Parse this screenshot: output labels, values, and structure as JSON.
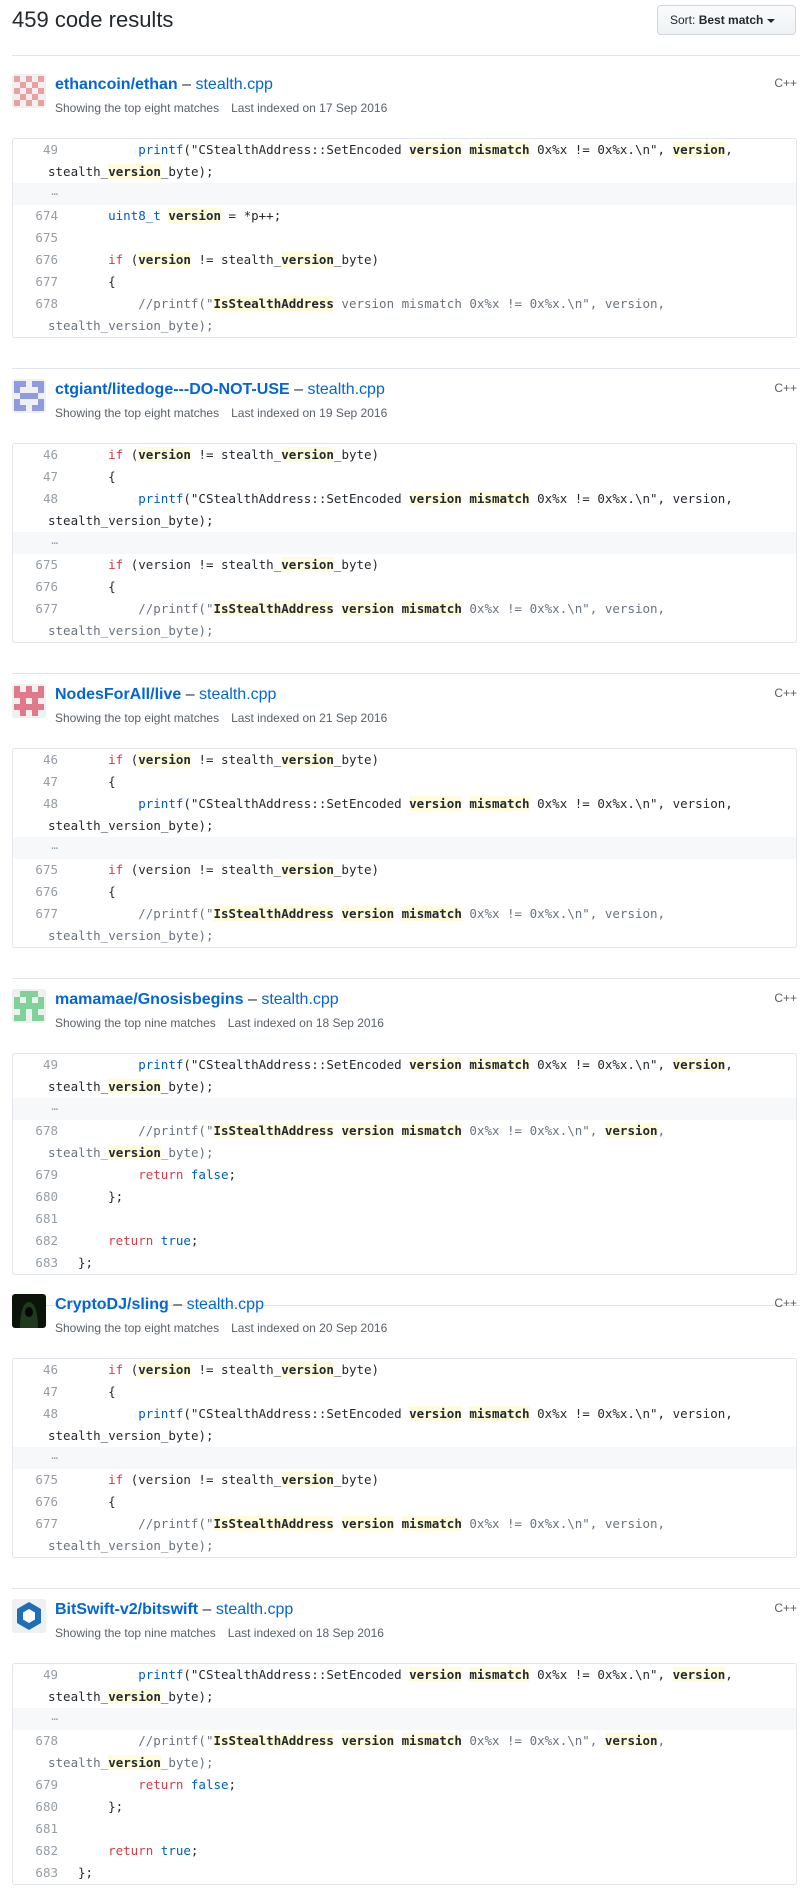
{
  "header": {
    "results_count": "459 code results",
    "sort_label": "Sort:",
    "sort_value": "Best match"
  },
  "results": [
    {
      "repo": "ethancoin/ethan",
      "file": "stealth.cpp",
      "language": "C++",
      "matches": "Showing the top eight matches",
      "indexed": "Last indexed on 17 Sep 2016",
      "avatar_color": "#e8a0a0",
      "lines": [
        {
          "n": "49",
          "segs": [
            [
              "t",
              "        "
            ],
            [
              "ty",
              "printf"
            ],
            [
              "t",
              "(\"CStealthAddress::SetEncoded "
            ],
            [
              "m",
              "version"
            ],
            [
              "t",
              " "
            ],
            [
              "m",
              "mismatch"
            ],
            [
              "t",
              " 0x%x != 0x%x.\\n\", "
            ],
            [
              "m",
              "version"
            ],
            [
              "t",
              ","
            ]
          ],
          "cont": [
            [
              "t",
              "stealth_"
            ],
            [
              "m",
              "version"
            ],
            [
              "t",
              "_byte);"
            ]
          ]
        },
        {
          "gap": true
        },
        {
          "n": "674",
          "segs": [
            [
              "t",
              "    "
            ],
            [
              "ty",
              "uint8_t"
            ],
            [
              "t",
              " "
            ],
            [
              "m",
              "version"
            ],
            [
              "t",
              " = *p++;"
            ]
          ]
        },
        {
          "n": "675",
          "segs": [
            [
              "t",
              ""
            ]
          ]
        },
        {
          "n": "676",
          "segs": [
            [
              "t",
              "    "
            ],
            [
              "kw",
              "if"
            ],
            [
              "t",
              " ("
            ],
            [
              "m",
              "version"
            ],
            [
              "t",
              " != stealth_"
            ],
            [
              "m",
              "version"
            ],
            [
              "t",
              "_byte)"
            ]
          ]
        },
        {
          "n": "677",
          "segs": [
            [
              "t",
              "    {"
            ]
          ]
        },
        {
          "n": "678",
          "segs": [
            [
              "t",
              "        "
            ],
            [
              "cm",
              "//printf(\""
            ],
            [
              "m",
              "IsStealthAddress"
            ],
            [
              "cm",
              " version mismatch 0x%x != 0x%x.\\n\", version,"
            ]
          ],
          "cont": [
            [
              "cm",
              "stealth_version_byte);"
            ]
          ]
        }
      ]
    },
    {
      "repo": "ctgiant/litedoge---DO-NOT-USE",
      "file": "stealth.cpp",
      "language": "C++",
      "matches": "Showing the top eight matches",
      "indexed": "Last indexed on 19 Sep 2016",
      "avatar_color": "#8f9be0",
      "lines": [
        {
          "n": "46",
          "segs": [
            [
              "t",
              "    "
            ],
            [
              "kw",
              "if"
            ],
            [
              "t",
              " ("
            ],
            [
              "m",
              "version"
            ],
            [
              "t",
              " != stealth_"
            ],
            [
              "m",
              "version"
            ],
            [
              "t",
              "_byte)"
            ]
          ]
        },
        {
          "n": "47",
          "segs": [
            [
              "t",
              "    {"
            ]
          ]
        },
        {
          "n": "48",
          "segs": [
            [
              "t",
              "        "
            ],
            [
              "ty",
              "printf"
            ],
            [
              "t",
              "(\"CStealthAddress::SetEncoded "
            ],
            [
              "m",
              "version"
            ],
            [
              "t",
              " "
            ],
            [
              "m",
              "mismatch"
            ],
            [
              "t",
              " 0x%x != 0x%x.\\n\", version,"
            ]
          ],
          "cont": [
            [
              "t",
              "stealth_version_byte);"
            ]
          ]
        },
        {
          "gap": true
        },
        {
          "n": "675",
          "segs": [
            [
              "t",
              "    "
            ],
            [
              "kw",
              "if"
            ],
            [
              "t",
              " (version != stealth_"
            ],
            [
              "m",
              "version"
            ],
            [
              "t",
              "_byte)"
            ]
          ]
        },
        {
          "n": "676",
          "segs": [
            [
              "t",
              "    {"
            ]
          ]
        },
        {
          "n": "677",
          "segs": [
            [
              "t",
              "        "
            ],
            [
              "cm",
              "//printf(\""
            ],
            [
              "m",
              "IsStealthAddress"
            ],
            [
              "t",
              " "
            ],
            [
              "m",
              "version"
            ],
            [
              "t",
              " "
            ],
            [
              "m",
              "mismatch"
            ],
            [
              "cm",
              " 0x%x != 0x%x.\\n\", version,"
            ]
          ],
          "cont": [
            [
              "cm",
              "stealth_version_byte);"
            ]
          ]
        }
      ]
    },
    {
      "repo": "NodesForAll/live",
      "file": "stealth.cpp",
      "language": "C++",
      "matches": "Showing the top eight matches",
      "indexed": "Last indexed on 21 Sep 2016",
      "avatar_color": "#e07a8a",
      "lines": [
        {
          "n": "46",
          "segs": [
            [
              "t",
              "    "
            ],
            [
              "kw",
              "if"
            ],
            [
              "t",
              " ("
            ],
            [
              "m",
              "version"
            ],
            [
              "t",
              " != stealth_"
            ],
            [
              "m",
              "version"
            ],
            [
              "t",
              "_byte)"
            ]
          ]
        },
        {
          "n": "47",
          "segs": [
            [
              "t",
              "    {"
            ]
          ]
        },
        {
          "n": "48",
          "segs": [
            [
              "t",
              "        "
            ],
            [
              "ty",
              "printf"
            ],
            [
              "t",
              "(\"CStealthAddress::SetEncoded "
            ],
            [
              "m",
              "version"
            ],
            [
              "t",
              " "
            ],
            [
              "m",
              "mismatch"
            ],
            [
              "t",
              " 0x%x != 0x%x.\\n\", version,"
            ]
          ],
          "cont": [
            [
              "t",
              "stealth_version_byte);"
            ]
          ]
        },
        {
          "gap": true
        },
        {
          "n": "675",
          "segs": [
            [
              "t",
              "    "
            ],
            [
              "kw",
              "if"
            ],
            [
              "t",
              " (version != stealth_"
            ],
            [
              "m",
              "version"
            ],
            [
              "t",
              "_byte)"
            ]
          ]
        },
        {
          "n": "676",
          "segs": [
            [
              "t",
              "    {"
            ]
          ]
        },
        {
          "n": "677",
          "segs": [
            [
              "t",
              "        "
            ],
            [
              "cm",
              "//printf(\""
            ],
            [
              "m",
              "IsStealthAddress"
            ],
            [
              "t",
              " "
            ],
            [
              "m",
              "version"
            ],
            [
              "t",
              " "
            ],
            [
              "m",
              "mismatch"
            ],
            [
              "cm",
              " 0x%x != 0x%x.\\n\", version,"
            ]
          ],
          "cont": [
            [
              "cm",
              "stealth_version_byte);"
            ]
          ]
        }
      ]
    },
    {
      "repo": "mamamae/Gnosisbegins",
      "file": "stealth.cpp",
      "language": "C++",
      "matches": "Showing the top nine matches",
      "indexed": "Last indexed on 18 Sep 2016",
      "avatar_color": "#7fd39a",
      "lines": [
        {
          "n": "49",
          "segs": [
            [
              "t",
              "        "
            ],
            [
              "ty",
              "printf"
            ],
            [
              "t",
              "(\"CStealthAddress::SetEncoded "
            ],
            [
              "m",
              "version"
            ],
            [
              "t",
              " "
            ],
            [
              "m",
              "mismatch"
            ],
            [
              "t",
              " 0x%x != 0x%x.\\n\", "
            ],
            [
              "m",
              "version"
            ],
            [
              "t",
              ","
            ]
          ],
          "cont": [
            [
              "t",
              "stealth_"
            ],
            [
              "m",
              "version"
            ],
            [
              "t",
              "_byte);"
            ]
          ]
        },
        {
          "gap": true
        },
        {
          "n": "678",
          "segs": [
            [
              "t",
              "        "
            ],
            [
              "cm",
              "//printf(\""
            ],
            [
              "m",
              "IsStealthAddress"
            ],
            [
              "t",
              " "
            ],
            [
              "m",
              "version"
            ],
            [
              "t",
              " "
            ],
            [
              "m",
              "mismatch"
            ],
            [
              "cm",
              " 0x%x != 0x%x.\\n\", "
            ],
            [
              "m",
              "version"
            ],
            [
              "cm",
              ","
            ]
          ],
          "cont": [
            [
              "cm",
              "stealth_"
            ],
            [
              "m",
              "version"
            ],
            [
              "cm",
              "_byte);"
            ]
          ]
        },
        {
          "n": "679",
          "segs": [
            [
              "t",
              "        "
            ],
            [
              "kw",
              "return"
            ],
            [
              "t",
              " "
            ],
            [
              "ty",
              "false"
            ],
            [
              "t",
              ";"
            ]
          ]
        },
        {
          "n": "680",
          "segs": [
            [
              "t",
              "    };"
            ]
          ]
        },
        {
          "n": "681",
          "segs": [
            [
              "t",
              ""
            ]
          ]
        },
        {
          "n": "682",
          "segs": [
            [
              "t",
              "    "
            ],
            [
              "kw",
              "return"
            ],
            [
              "t",
              " "
            ],
            [
              "ty",
              "true"
            ],
            [
              "t",
              ";"
            ]
          ]
        },
        {
          "n": "683",
          "segs": [
            [
              "t",
              "};"
            ]
          ]
        }
      ]
    },
    {
      "repo": "CryptoDJ/sling",
      "file": "stealth.cpp",
      "language": "C++",
      "matches": "Showing the top eight matches",
      "indexed": "Last indexed on 20 Sep 2016",
      "avatar_color": "#1f3a1c",
      "lines": [
        {
          "n": "46",
          "segs": [
            [
              "t",
              "    "
            ],
            [
              "kw",
              "if"
            ],
            [
              "t",
              " ("
            ],
            [
              "m",
              "version"
            ],
            [
              "t",
              " != stealth_"
            ],
            [
              "m",
              "version"
            ],
            [
              "t",
              "_byte)"
            ]
          ]
        },
        {
          "n": "47",
          "segs": [
            [
              "t",
              "    {"
            ]
          ]
        },
        {
          "n": "48",
          "segs": [
            [
              "t",
              "        "
            ],
            [
              "ty",
              "printf"
            ],
            [
              "t",
              "(\"CStealthAddress::SetEncoded "
            ],
            [
              "m",
              "version"
            ],
            [
              "t",
              " "
            ],
            [
              "m",
              "mismatch"
            ],
            [
              "t",
              " 0x%x != 0x%x.\\n\", version,"
            ]
          ],
          "cont": [
            [
              "t",
              "stealth_version_byte);"
            ]
          ]
        },
        {
          "gap": true
        },
        {
          "n": "675",
          "segs": [
            [
              "t",
              "    "
            ],
            [
              "kw",
              "if"
            ],
            [
              "t",
              " (version != stealth_"
            ],
            [
              "m",
              "version"
            ],
            [
              "t",
              "_byte)"
            ]
          ]
        },
        {
          "n": "676",
          "segs": [
            [
              "t",
              "    {"
            ]
          ]
        },
        {
          "n": "677",
          "segs": [
            [
              "t",
              "        "
            ],
            [
              "cm",
              "//printf(\""
            ],
            [
              "m",
              "IsStealthAddress"
            ],
            [
              "t",
              " "
            ],
            [
              "m",
              "version"
            ],
            [
              "t",
              " "
            ],
            [
              "m",
              "mismatch"
            ],
            [
              "cm",
              " 0x%x != 0x%x.\\n\", version,"
            ]
          ],
          "cont": [
            [
              "cm",
              "stealth_version_byte);"
            ]
          ]
        }
      ]
    },
    {
      "repo": "BitSwift-v2/bitswift",
      "file": "stealth.cpp",
      "language": "C++",
      "matches": "Showing the top nine matches",
      "indexed": "Last indexed on 18 Sep 2016",
      "avatar_color": "#1e6fb8",
      "lines": [
        {
          "n": "49",
          "segs": [
            [
              "t",
              "        "
            ],
            [
              "ty",
              "printf"
            ],
            [
              "t",
              "(\"CStealthAddress::SetEncoded "
            ],
            [
              "m",
              "version"
            ],
            [
              "t",
              " "
            ],
            [
              "m",
              "mismatch"
            ],
            [
              "t",
              " 0x%x != 0x%x.\\n\", "
            ],
            [
              "m",
              "version"
            ],
            [
              "t",
              ","
            ]
          ],
          "cont": [
            [
              "t",
              "stealth_"
            ],
            [
              "m",
              "version"
            ],
            [
              "t",
              "_byte);"
            ]
          ]
        },
        {
          "gap": true
        },
        {
          "n": "678",
          "segs": [
            [
              "t",
              "        "
            ],
            [
              "cm",
              "//printf(\""
            ],
            [
              "m",
              "IsStealthAddress"
            ],
            [
              "t",
              " "
            ],
            [
              "m",
              "version"
            ],
            [
              "t",
              " "
            ],
            [
              "m",
              "mismatch"
            ],
            [
              "cm",
              " 0x%x != 0x%x.\\n\", "
            ],
            [
              "m",
              "version"
            ],
            [
              "cm",
              ","
            ]
          ],
          "cont": [
            [
              "cm",
              "stealth_"
            ],
            [
              "m",
              "version"
            ],
            [
              "cm",
              "_byte);"
            ]
          ]
        },
        {
          "n": "679",
          "segs": [
            [
              "t",
              "        "
            ],
            [
              "kw",
              "return"
            ],
            [
              "t",
              " "
            ],
            [
              "ty",
              "false"
            ],
            [
              "t",
              ";"
            ]
          ]
        },
        {
          "n": "680",
          "segs": [
            [
              "t",
              "    };"
            ]
          ]
        },
        {
          "n": "681",
          "segs": [
            [
              "t",
              ""
            ]
          ]
        },
        {
          "n": "682",
          "segs": [
            [
              "t",
              "    "
            ],
            [
              "kw",
              "return"
            ],
            [
              "t",
              " "
            ],
            [
              "ty",
              "true"
            ],
            [
              "t",
              ";"
            ]
          ]
        },
        {
          "n": "683",
          "segs": [
            [
              "t",
              "};"
            ]
          ]
        }
      ]
    }
  ]
}
